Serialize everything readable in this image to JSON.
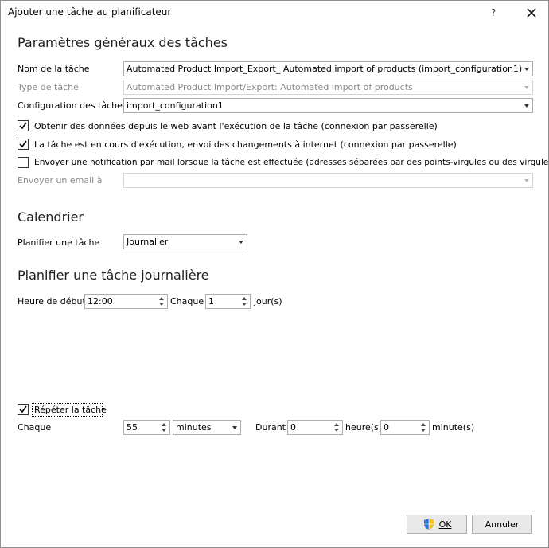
{
  "window": {
    "title": "Ajouter une tâche au planificateur",
    "help": "?"
  },
  "general": {
    "heading": "Paramètres généraux des tâches",
    "task_name_label": "Nom de la tâche",
    "task_name_value": "Automated Product Import_Export_ Automated import of products (import_configuration1)",
    "task_type_label": "Type de tâche",
    "task_type_value": "Automated Product Import/Export: Automated import of products",
    "task_config_label": "Configuration des tâches",
    "task_config_value": "import_configuration1",
    "opt1_label": "Obtenir des données depuis le web avant l'exécution de la tâche (connexion par passerelle)",
    "opt1_checked": true,
    "opt2_label": "La tâche est en cours d'exécution, envoi des changements à internet (connexion par passerelle)",
    "opt2_checked": true,
    "opt3_label": "Envoyer une notification par mail lorsque la tâche est effectuée (adresses séparées par des points-virgules ou des virgules)",
    "opt3_checked": false,
    "email_label": "Envoyer un email à",
    "email_value": ""
  },
  "calendar": {
    "heading": "Calendrier",
    "schedule_label": "Planifier une tâche",
    "schedule_value": "Journalier"
  },
  "daily": {
    "heading": "Planifier une tâche journalière",
    "start_label": "Heure de début",
    "start_value": "12:00",
    "every_label": "Chaque",
    "every_value": "1",
    "unit_label": "jour(s)"
  },
  "repeat": {
    "label": "Répéter la tâche",
    "checked": true,
    "every_label": "Chaque",
    "every_value": "55",
    "unit_value": "minutes",
    "duration_label": "Durant",
    "hours_value": "0",
    "hours_label": "heure(s)",
    "minutes_value": "0",
    "minutes_label": "minute(s)"
  },
  "footer": {
    "ok_label": "OK",
    "cancel_label": "Annuler"
  }
}
